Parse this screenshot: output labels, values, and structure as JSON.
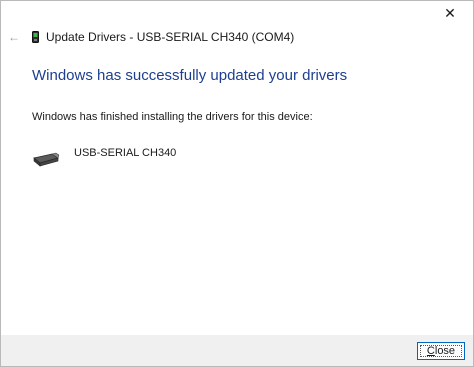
{
  "titlebar": {
    "close_glyph": "✕"
  },
  "nav": {
    "back_glyph": "←",
    "title": "Update Drivers - USB-SERIAL CH340 (COM4)"
  },
  "main": {
    "heading": "Windows has successfully updated your drivers",
    "message": "Windows has finished installing the drivers for this device:",
    "device_name": "USB-SERIAL CH340"
  },
  "footer": {
    "close_label": "Close"
  },
  "colors": {
    "heading": "#1e3f8f",
    "accent_border": "#0067c0",
    "footer_bg": "#f0f0f0"
  },
  "icons": {
    "back": "back-arrow-icon",
    "wizard": "usb-device-icon",
    "device": "serial-adapter-icon",
    "window_close": "close-icon"
  }
}
